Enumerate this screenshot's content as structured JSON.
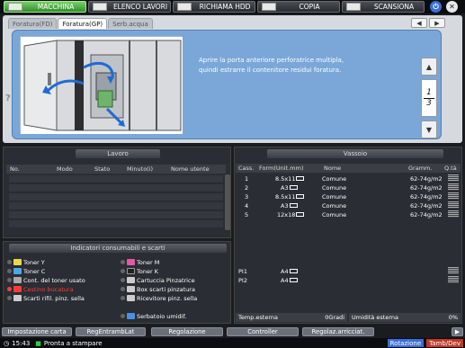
{
  "topbar": {
    "items": [
      {
        "label": "MACCHINA",
        "active": true
      },
      {
        "label": "ELENCO LAVORI",
        "active": false
      },
      {
        "label": "RICHIAMA HDD",
        "active": false
      },
      {
        "label": "COPIA",
        "active": false
      },
      {
        "label": "SCANSIONA",
        "active": false
      }
    ],
    "stop_symbol": "⏻",
    "close_symbol": "✕"
  },
  "tabs": [
    {
      "label": "Foratura(FD)"
    },
    {
      "label": "Foratura(GP)"
    },
    {
      "label": "Serb.acqua"
    }
  ],
  "guide": {
    "help": "?",
    "message_line1": "Aprire la porta anteriore perforatrice multipla,",
    "message_line2": "quindi estrarre il contenitore residui foratura.",
    "page_current": "1",
    "page_total": "3"
  },
  "lavoro": {
    "title": "Lavoro",
    "columns": [
      "No.",
      "Modo",
      "Stato",
      "Minuto(i)",
      "Nome utente"
    ]
  },
  "consumables": {
    "title": "Indicatori consumabili e scarti",
    "items": [
      {
        "label": "Toner Y",
        "color": "#e8d84a",
        "warn": false
      },
      {
        "label": "Toner M",
        "color": "#e05aa8",
        "warn": false
      },
      {
        "label": "Toner C",
        "color": "#4aa8e8",
        "warn": false
      },
      {
        "label": "Toner K",
        "color": "#222222",
        "warn": false
      },
      {
        "label": "Cont. del toner usato",
        "color": "#aaaaaa",
        "warn": false
      },
      {
        "label": "Cartuccia Pinzatrice",
        "color": "#cccccc",
        "warn": false
      },
      {
        "label": "Cestino bucatura",
        "color": "#ff3b3b",
        "warn": true
      },
      {
        "label": "Box scarti pinzatura",
        "color": "#cccccc",
        "warn": false
      },
      {
        "label": "Scarti rifil. pinz. sella",
        "color": "#cccccc",
        "warn": false
      },
      {
        "label": "Ricevitore pinz. sella",
        "color": "#cccccc",
        "warn": false
      },
      {
        "label": "Serbatoio umidif.",
        "color": "#4a8ee8",
        "warn": false
      }
    ]
  },
  "vassoio": {
    "title": "Vassoio",
    "columns": [
      "Cass.",
      "Form(Unit.mm)",
      "Nome",
      "Gramm.",
      "Q.tà"
    ],
    "rows": [
      {
        "cass": "1",
        "form": "8.5x11",
        "name": "Comune",
        "gramm": "62-74g/m2"
      },
      {
        "cass": "2",
        "form": "A3",
        "name": "Comune",
        "gramm": "62-74g/m2"
      },
      {
        "cass": "3",
        "form": "8.5x11",
        "name": "Comune",
        "gramm": "62-74g/m2"
      },
      {
        "cass": "4",
        "form": "A3",
        "name": "Comune",
        "gramm": "62-74g/m2"
      },
      {
        "cass": "5",
        "form": "12x18",
        "name": "Comune",
        "gramm": "62-74g/m2"
      }
    ],
    "pi_rows": [
      {
        "cass": "PI1",
        "form": "A4"
      },
      {
        "cass": "PI2",
        "form": "A4"
      }
    ],
    "temp_label": "Temp.esterna",
    "temp_value": "0Gradi",
    "hum_label": "Umidità esterna",
    "hum_value": "0%"
  },
  "bottom_buttons": [
    "Impostazione carta",
    "RegEntrambLat",
    "Regolazione",
    "Controller",
    "Regolaz.arricciat."
  ],
  "status": {
    "time": "15:43",
    "message": "Pronta a stampare",
    "rotation": "Rotazione",
    "tamb": "Tamb/Dev"
  }
}
